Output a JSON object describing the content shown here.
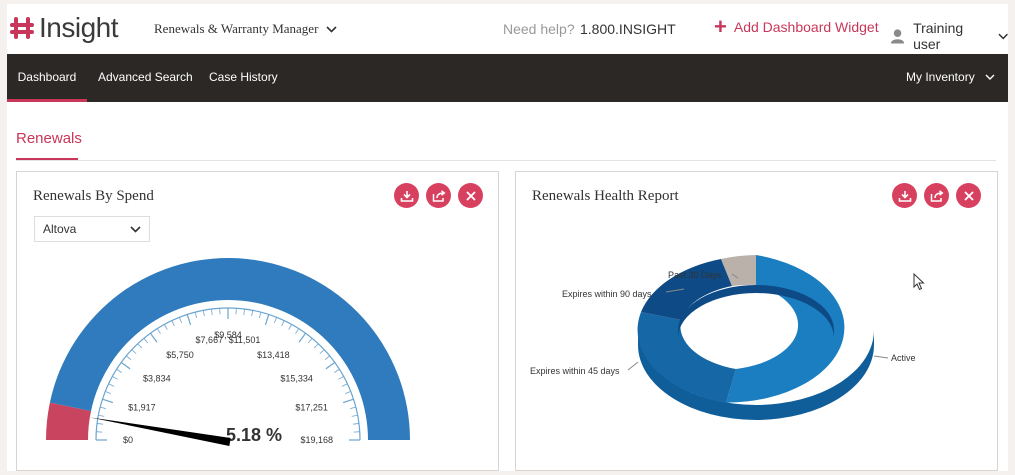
{
  "header": {
    "logo_text": "Insight",
    "app_switcher": "Renewals & Warranty Manager",
    "help_label": "Need help?",
    "phone": "1.800.INSIGHT",
    "add_widget": "Add Dashboard Widget",
    "user_name": "Training user"
  },
  "nav": {
    "items": [
      "Dashboard",
      "Advanced Search",
      "Case History"
    ],
    "active": "Dashboard",
    "right_menu": "My Inventory"
  },
  "section": {
    "tab": "Renewals"
  },
  "spend_panel": {
    "title": "Renewals By Spend",
    "vendor_select": "Altova",
    "gauge": {
      "ticks": [
        "$0",
        "$1,917",
        "$3,834",
        "$5,750",
        "$7,667",
        "$9,584",
        "$11,501",
        "$13,418",
        "$15,334",
        "$17,251",
        "$19,168"
      ],
      "value_label": "5.18 %",
      "value_fraction": 0.0518
    }
  },
  "health_panel": {
    "title": "Renewals Health Report",
    "slices": [
      {
        "label": "Active",
        "color": "#1a7ec1"
      },
      {
        "label": "Expires within 45 days",
        "color": "#1667a6"
      },
      {
        "label": "Expires within 90 days",
        "color": "#0d4a86"
      },
      {
        "label": "Past 30 Days",
        "color": "#b9b1aa"
      }
    ]
  },
  "colors": {
    "accent": "#c8375a",
    "nav_bg": "#2b2826",
    "gauge_blue": "#2f7bbd"
  },
  "icons": [
    "download-icon",
    "share-icon",
    "close-icon"
  ]
}
